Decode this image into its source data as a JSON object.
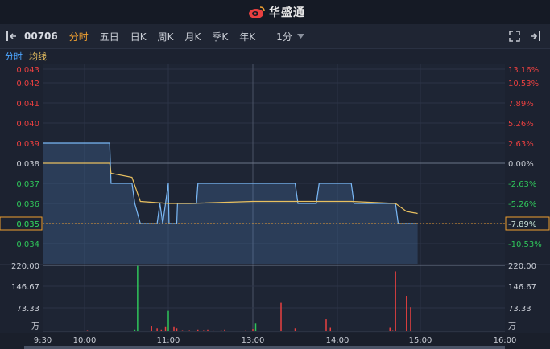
{
  "brand": {
    "name": "华盛通"
  },
  "toolbar": {
    "stock_code": "00706",
    "tabs": [
      "分时",
      "五日",
      "日K",
      "周K",
      "月K",
      "季K",
      "年K"
    ],
    "active_tab": "分时",
    "interval": "1分"
  },
  "legend": {
    "line1": "分时",
    "line2": "均线"
  },
  "chart_data": {
    "type": "line",
    "price_axis_labels": [
      "0.043",
      "0.042",
      "0.041",
      "0.040",
      "0.039",
      "0.038",
      "0.037",
      "0.036",
      "0.035",
      "0.034"
    ],
    "pct_axis_labels": [
      "13.16%",
      "10.53%",
      "7.89%",
      "5.26%",
      "2.63%",
      "0.00%",
      "-2.63%",
      "-5.26%",
      "-7.89%",
      "-10.53%"
    ],
    "prev_close": 0.038,
    "current_price": "0.035",
    "current_pct": "-7.89%",
    "time_labels": [
      "9:30",
      "10:00",
      "11:00",
      "13:00",
      "14:00",
      "15:00",
      "16:00"
    ],
    "volume_axis_labels": [
      "220.00",
      "146.67",
      "73.33"
    ],
    "volume_unit": "万",
    "price_series": [
      {
        "t": "9:30",
        "v": 0.039
      },
      {
        "t": "10:18",
        "v": 0.039
      },
      {
        "t": "10:19",
        "v": 0.037
      },
      {
        "t": "10:34",
        "v": 0.037
      },
      {
        "t": "10:36",
        "v": 0.036
      },
      {
        "t": "10:40",
        "v": 0.035
      },
      {
        "t": "10:52",
        "v": 0.035
      },
      {
        "t": "10:54",
        "v": 0.036
      },
      {
        "t": "10:56",
        "v": 0.035
      },
      {
        "t": "11:00",
        "v": 0.037
      },
      {
        "t": "11:01",
        "v": 0.035
      },
      {
        "t": "11:12",
        "v": 0.035
      },
      {
        "t": "11:13",
        "v": 0.036
      },
      {
        "t": "11:40",
        "v": 0.036
      },
      {
        "t": "11:42",
        "v": 0.037
      },
      {
        "t": "13:30",
        "v": 0.037
      },
      {
        "t": "13:32",
        "v": 0.036
      },
      {
        "t": "13:45",
        "v": 0.036
      },
      {
        "t": "13:47",
        "v": 0.037
      },
      {
        "t": "14:10",
        "v": 0.037
      },
      {
        "t": "14:12",
        "v": 0.036
      },
      {
        "t": "14:42",
        "v": 0.036
      },
      {
        "t": "14:44",
        "v": 0.035
      },
      {
        "t": "14:58",
        "v": 0.035
      }
    ],
    "avg_series": [
      {
        "t": "9:30",
        "v": 0.038
      },
      {
        "t": "10:18",
        "v": 0.038
      },
      {
        "t": "10:19",
        "v": 0.0375
      },
      {
        "t": "10:34",
        "v": 0.0373
      },
      {
        "t": "10:40",
        "v": 0.0361
      },
      {
        "t": "11:00",
        "v": 0.036
      },
      {
        "t": "11:30",
        "v": 0.036
      },
      {
        "t": "13:00",
        "v": 0.0361
      },
      {
        "t": "13:45",
        "v": 0.0361
      },
      {
        "t": "14:10",
        "v": 0.0361
      },
      {
        "t": "14:42",
        "v": 0.036
      },
      {
        "t": "14:50",
        "v": 0.0356
      },
      {
        "t": "14:58",
        "v": 0.0355
      }
    ],
    "volume_max": 220,
    "volume_bars": [
      {
        "t": "10:02",
        "v": 4,
        "dir": "up"
      },
      {
        "t": "10:36",
        "v": 6,
        "dir": "down"
      },
      {
        "t": "10:38",
        "v": 218,
        "dir": "down"
      },
      {
        "t": "10:48",
        "v": 16,
        "dir": "up"
      },
      {
        "t": "10:52",
        "v": 10,
        "dir": "up"
      },
      {
        "t": "10:55",
        "v": 6,
        "dir": "up"
      },
      {
        "t": "10:58",
        "v": 14,
        "dir": "up"
      },
      {
        "t": "11:00",
        "v": 68,
        "dir": "down"
      },
      {
        "t": "11:08",
        "v": 14,
        "dir": "up"
      },
      {
        "t": "11:12",
        "v": 10,
        "dir": "up"
      },
      {
        "t": "11:20",
        "v": 4,
        "dir": "up"
      },
      {
        "t": "11:30",
        "v": 4,
        "dir": "up"
      },
      {
        "t": "11:42",
        "v": 6,
        "dir": "up"
      },
      {
        "t": "11:50",
        "v": 4,
        "dir": "up"
      },
      {
        "t": "11:56",
        "v": 6,
        "dir": "up"
      },
      {
        "t": "12:04",
        "v": 3,
        "dir": "up"
      },
      {
        "t": "12:15",
        "v": 4,
        "dir": "up"
      },
      {
        "t": "12:20",
        "v": 6,
        "dir": "up"
      },
      {
        "t": "12:50",
        "v": 4,
        "dir": "up"
      },
      {
        "t": "13:00",
        "v": 8,
        "dir": "up"
      },
      {
        "t": "13:02",
        "v": 26,
        "dir": "down"
      },
      {
        "t": "13:13",
        "v": 2,
        "dir": "down"
      },
      {
        "t": "13:20",
        "v": 95,
        "dir": "up"
      },
      {
        "t": "13:30",
        "v": 10,
        "dir": "up"
      },
      {
        "t": "13:52",
        "v": 40,
        "dir": "up"
      },
      {
        "t": "13:55",
        "v": 12,
        "dir": "up"
      },
      {
        "t": "14:38",
        "v": 12,
        "dir": "up"
      },
      {
        "t": "14:40",
        "v": 4,
        "dir": "up"
      },
      {
        "t": "14:42",
        "v": 200,
        "dir": "up"
      },
      {
        "t": "14:50",
        "v": 118,
        "dir": "up"
      },
      {
        "t": "14:53",
        "v": 80,
        "dir": "up"
      }
    ]
  },
  "colors": {
    "up": "#e84040",
    "down": "#2fc45a",
    "price_line": "#7ab8f5",
    "avg_line": "#e8c060",
    "accent": "#f0a030"
  },
  "icons": {
    "collapse": "collapse-left-icon",
    "fullscreen": "fullscreen-icon",
    "expand": "expand-right-icon",
    "dropdown": "chevron-down-icon"
  }
}
